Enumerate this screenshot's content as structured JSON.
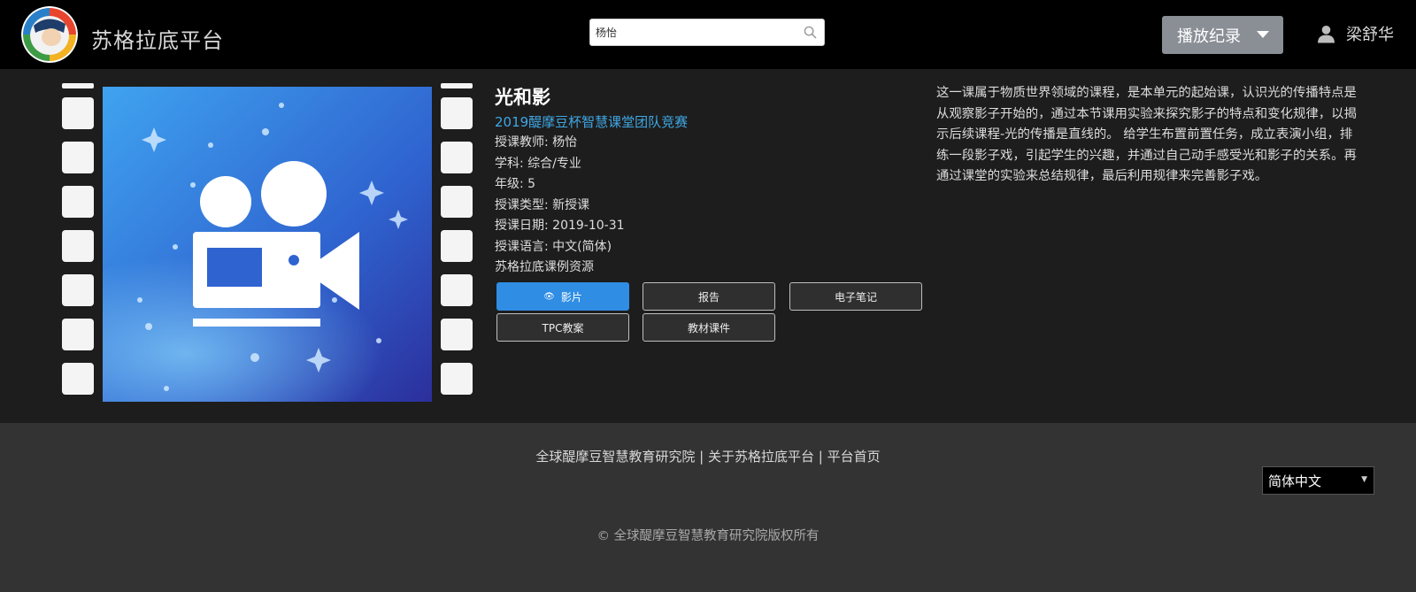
{
  "header": {
    "brand": "苏格拉底平台",
    "search": {
      "value": "杨怡",
      "placeholder": ""
    },
    "history_label": "播放纪录",
    "user_name": "梁舒华"
  },
  "course": {
    "title": "光和影",
    "subtitle": "2019醍摩豆杯智慧课堂团队竞赛",
    "teacher": "授课教师: 杨怡",
    "subject": "学科: 综合/专业",
    "grade": "年级: 5",
    "type": "授课类型: 新授课",
    "date": "授课日期: 2019-10-31",
    "language": "授课语言: 中文(简体)",
    "source": "苏格拉底课例资源",
    "buttons": {
      "video": "影片",
      "report": "报告",
      "notes": "电子笔记",
      "tpc": "TPC教案",
      "materials": "教材课件"
    },
    "description": "这一课属于物质世界领域的课程，是本单元的起始课，认识光的传播特点是从观察影子开始的，通过本节课用实验来探究影子的特点和变化规律，以揭示后续课程-光的传播是直线的。 给学生布置前置任务，成立表演小组，排练一段影子戏，引起学生的兴趣，并通过自己动手感受光和影子的关系。再通过课堂的实验来总结规律，最后利用规律来完善影子戏。"
  },
  "footer": {
    "link1": "全球醍摩豆智慧教育研究院",
    "sep": " | ",
    "link2": "关于苏格拉底平台",
    "link3": "平台首页",
    "language": "简体中文",
    "copyright": "© 全球醍摩豆智慧教育研究院版权所有"
  },
  "colors": {
    "accent": "#2f8de4",
    "subtitle": "#3fa7e4",
    "header_bg": "#000000",
    "main_bg": "#1d1d1d",
    "footer_bg": "#333333"
  },
  "icons": {
    "search": "search-icon",
    "caret": "chevron-down-icon",
    "user": "user-icon",
    "eye": "eye-icon",
    "thumbnail": "video-camera-icon"
  }
}
